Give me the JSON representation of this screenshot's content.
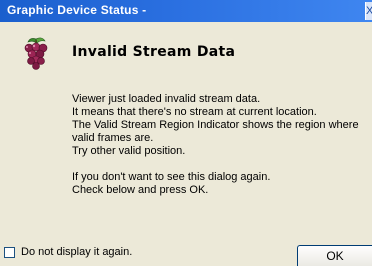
{
  "window": {
    "title": "Graphic Device Status -",
    "close_glyph": "X"
  },
  "dialog": {
    "icon": "grapes-icon",
    "heading": "Invalid Stream Data",
    "message_lines_1": [
      "Viewer just loaded invalid stream data.",
      "It means that there's no stream at current location.",
      "The Valid Stream Region Indicator shows the region where",
      "valid frames are.",
      "Try other valid position."
    ],
    "message_lines_2": [
      "If you don't want to see this dialog again.",
      "Check below and press OK."
    ]
  },
  "footer": {
    "checkbox_label": "Do not display it again.",
    "checkbox_checked": false,
    "ok_label": "OK"
  }
}
